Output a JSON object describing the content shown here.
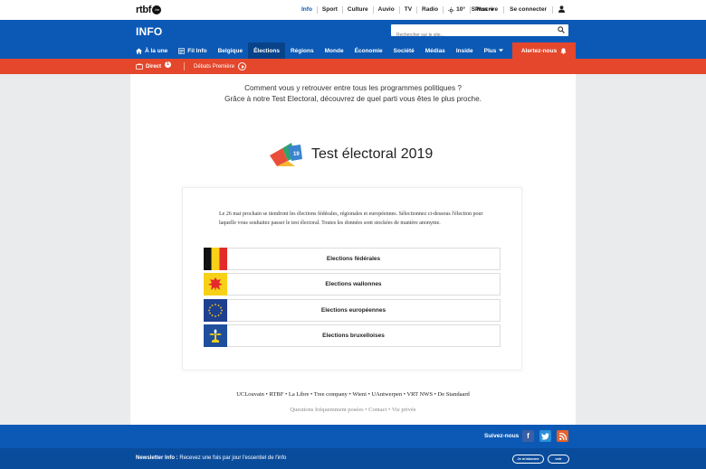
{
  "topbar": {
    "logo_text": "rtbf",
    "logo_dot": ".be",
    "nav": [
      "Info",
      "Sport",
      "Culture",
      "Auvio",
      "TV",
      "Radio",
      "10°",
      "Plus"
    ],
    "signup": "S'inscrire",
    "login": "Se connecter"
  },
  "header": {
    "brand": "INFO",
    "search_placeholder": "Rechercher sur le site..."
  },
  "nav": {
    "items": [
      "À la une",
      "Fil Info",
      "Belgique",
      "Élections",
      "Régions",
      "Monde",
      "Économie",
      "Société",
      "Médias",
      "Inside",
      "Plus"
    ],
    "alert_label": "Alertez-nous"
  },
  "live": {
    "direct_label": "Direct",
    "direct_count": "1",
    "program": "Débats Première"
  },
  "main": {
    "intro_line1": "Comment vous y retrouver entre tous les programmes politiques ?",
    "intro_line2": "Grâce à notre Test Electoral, découvrez de quel parti vous êtes le plus proche.",
    "test_title": "Test électoral 2019",
    "logo_badge": "19",
    "card_text": "Le 26 mai prochain se tiendront les élections fédérales, régionales et européennes. Sélectionnez ci-dessous l'élection pour laquelle vous souhaitez passer le test électoral. Toutes les données sont stockées de manière anonyme.",
    "elections": [
      {
        "label": "Elections fédérales"
      },
      {
        "label": "Elections wallonnes"
      },
      {
        "label": "Elections européennes"
      },
      {
        "label": "Elections bruxelloises"
      }
    ],
    "partners": "UCLouvain • RTBF • La Libre • Tree company • Wieni • UAntwerpen • VRT NWS • De Standaard",
    "links": "Questions fréquemment posées • Contact • Vie privée"
  },
  "footer": {
    "follow_label": "Suivez-nous",
    "social": [
      "f",
      "t",
      "rss"
    ],
    "newsletter_bold": "Newsletter Info :",
    "newsletter_text": " Recevez une fois par jour l'essentiel de l'info",
    "subscribe_label": "Je m'abonne",
    "see_label": "voir"
  },
  "colors": {
    "blue": "#0b59b5",
    "dark_blue": "#08438a",
    "red": "#e4472b"
  }
}
